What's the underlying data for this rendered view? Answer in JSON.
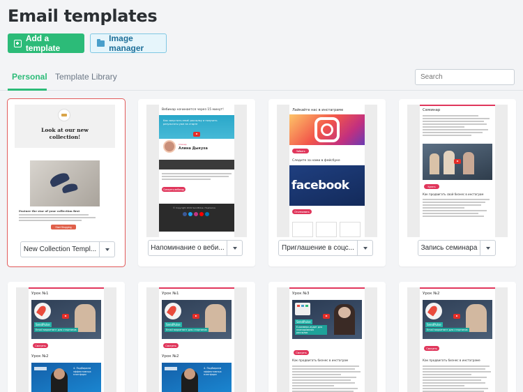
{
  "page": {
    "title": "Email templates"
  },
  "toolbar": {
    "add_label": "Add a template",
    "image_manager_label": "Image manager"
  },
  "tabs": [
    {
      "label": "Personal",
      "active": true
    },
    {
      "label": "Template Library",
      "active": false
    }
  ],
  "search": {
    "placeholder": "Search"
  },
  "colors": {
    "accent": "#2cbb78",
    "selection": "#e25a5a",
    "brand_red": "#e0365b"
  },
  "cards": [
    {
      "name": "New Collection Templ...",
      "preview": {
        "headline": "Look at our new collection!",
        "feature": "Feature the star of your collection first",
        "cta": "Start Shopping"
      }
    },
    {
      "name": "Напоминание о веби...",
      "preview": {
        "heading": "Вебинар начинается через 15 минут!",
        "banner": "Как запустить email рассылку и получить результаты уже на старте",
        "speaker_role": "Спикер",
        "speaker": "Алина Дыкуха",
        "cta": "Смотреть вебинар",
        "footer": "© Copyright 2019 SendPulse. Подписка"
      }
    },
    {
      "name": "Приглашение в соцс...",
      "preview": {
        "heading": "Лайкайте нас в инстаграме",
        "cta1": "Лайкать",
        "heading2": "Следите за нами в фейсбуке",
        "logo": "facebook",
        "cta2": "Отслеживать"
      }
    },
    {
      "name": "Запись семинара",
      "preview": {
        "heading": "Семинар",
        "cta": "Купить",
        "subheading": "Как продвигать свой бизнес в инстаграм"
      }
    },
    {
      "name": "",
      "preview": {
        "heading": "Урок №1",
        "brand": "SendPulse",
        "banner": "Email маркетинг для стартапов",
        "cta": "Смотреть",
        "heading2": "Урок №2",
        "banner2": "4. Подбираем эффективных платформ"
      }
    },
    {
      "name": "",
      "preview": {
        "heading": "Урок №1",
        "brand": "SendPulse",
        "banner": "Email маркетинг для стартапов",
        "cta": "Смотреть",
        "heading2": "Урок №2",
        "banner2": "4. Подбираем эффективных платформ"
      }
    },
    {
      "name": "",
      "preview": {
        "heading": "Урок №3",
        "brand": "SendPulse",
        "banner": "Е-коммерс-аудит для планирования рассылок",
        "cta": "Смотреть",
        "subheading": "Как продвигать бизнес в инстаграм"
      }
    },
    {
      "name": "",
      "preview": {
        "heading": "Урок №2",
        "brand": "SendPulse",
        "banner": "Email маркетинг для стартапов",
        "cta": "Смотреть",
        "subheading": "Как продвигать бизнес в инстаграме"
      }
    }
  ]
}
